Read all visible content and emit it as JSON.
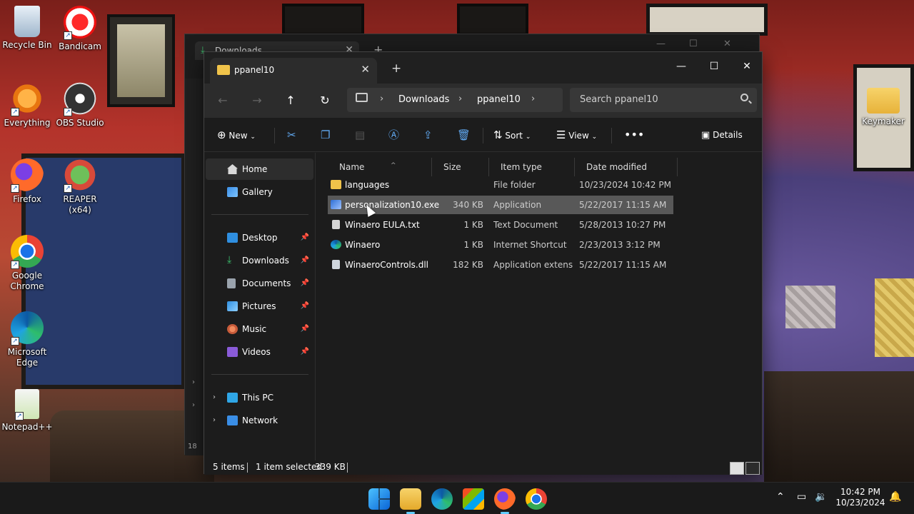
{
  "desktop": {
    "icons": [
      {
        "label": "Recycle Bin"
      },
      {
        "label": "Bandicam"
      },
      {
        "label": "Everything"
      },
      {
        "label": "OBS Studio"
      },
      {
        "label": "Firefox"
      },
      {
        "label": "REAPER (x64)"
      },
      {
        "label": "Google Chrome"
      },
      {
        "label": "Microsoft Edge"
      },
      {
        "label": "Notepad++"
      },
      {
        "label": "Keymaker"
      }
    ]
  },
  "back_window": {
    "tab_title": "Downloads",
    "status_prefix": "18"
  },
  "window": {
    "tab_title": "ppanel10",
    "address": {
      "crumbs": [
        "Downloads",
        "ppanel10"
      ]
    },
    "search": {
      "placeholder": "Search ppanel10"
    },
    "toolbar": {
      "new_label": "New",
      "sort_label": "Sort",
      "view_label": "View",
      "details_label": "Details"
    },
    "sidebar": {
      "home": "Home",
      "gallery": "Gallery",
      "pinned": [
        "Desktop",
        "Downloads",
        "Documents",
        "Pictures",
        "Music",
        "Videos"
      ],
      "this_pc": "This PC",
      "network": "Network"
    },
    "columns": {
      "name": "Name",
      "size": "Size",
      "type": "Item type",
      "date": "Date modified"
    },
    "files": [
      {
        "name": "languages",
        "size": "",
        "type": "File folder",
        "date": "10/23/2024 10:42 PM",
        "icon": "folder-icon"
      },
      {
        "name": "personalization10.exe",
        "size": "340 KB",
        "type": "Application",
        "date": "5/22/2017 11:15 AM",
        "icon": "application-icon"
      },
      {
        "name": "Winaero EULA.txt",
        "size": "1 KB",
        "type": "Text Document",
        "date": "5/28/2013 10:27 PM",
        "icon": "text-file-icon"
      },
      {
        "name": "Winaero",
        "size": "1 KB",
        "type": "Internet Shortcut",
        "date": "2/23/2013 3:12 PM",
        "icon": "internet-shortcut-icon"
      },
      {
        "name": "WinaeroControls.dll",
        "size": "182 KB",
        "type": "Application extens...",
        "date": "5/22/2017 11:15 AM",
        "icon": "dll-file-icon"
      }
    ],
    "status": {
      "items": "5 items",
      "selected": "1 item selected",
      "size": "339 KB"
    }
  },
  "taskbar": {
    "time": "10:42 PM",
    "date": "10/23/2024"
  }
}
